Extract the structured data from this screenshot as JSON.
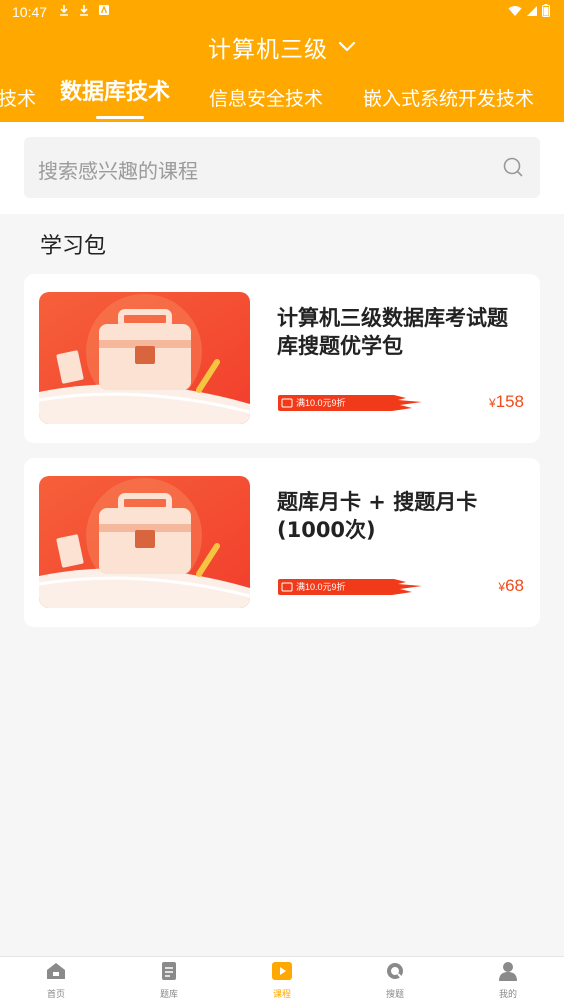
{
  "status": {
    "time": "10:47"
  },
  "header": {
    "title": "计算机三级",
    "tabs": [
      {
        "label": "技术",
        "active": false
      },
      {
        "label": "数据库技术",
        "active": true
      },
      {
        "label": "信息安全技术",
        "active": false
      },
      {
        "label": "嵌入式系统开发技术",
        "active": false
      }
    ]
  },
  "search": {
    "placeholder": "搜索感兴趣的课程"
  },
  "section": {
    "title": "学习包"
  },
  "products": [
    {
      "name": "计算机三级数据库考试题库搜题优学包",
      "coupon": "满10.0元9折",
      "currency": "¥",
      "price": "158"
    },
    {
      "name": "题库月卡 + 搜题月卡(1000次)",
      "coupon": "满10.0元9折",
      "currency": "¥",
      "price": "68"
    }
  ],
  "bottom_nav": [
    {
      "label": "首页",
      "icon": "home-icon",
      "active": false
    },
    {
      "label": "题库",
      "icon": "document-icon",
      "active": false
    },
    {
      "label": "课程",
      "icon": "play-icon",
      "active": true
    },
    {
      "label": "搜题",
      "icon": "search-icon",
      "active": false
    },
    {
      "label": "我的",
      "icon": "user-icon",
      "active": false
    }
  ],
  "colors": {
    "accent": "#FFA800",
    "price": "#F04C1B",
    "coupon": "#F03A1A"
  }
}
